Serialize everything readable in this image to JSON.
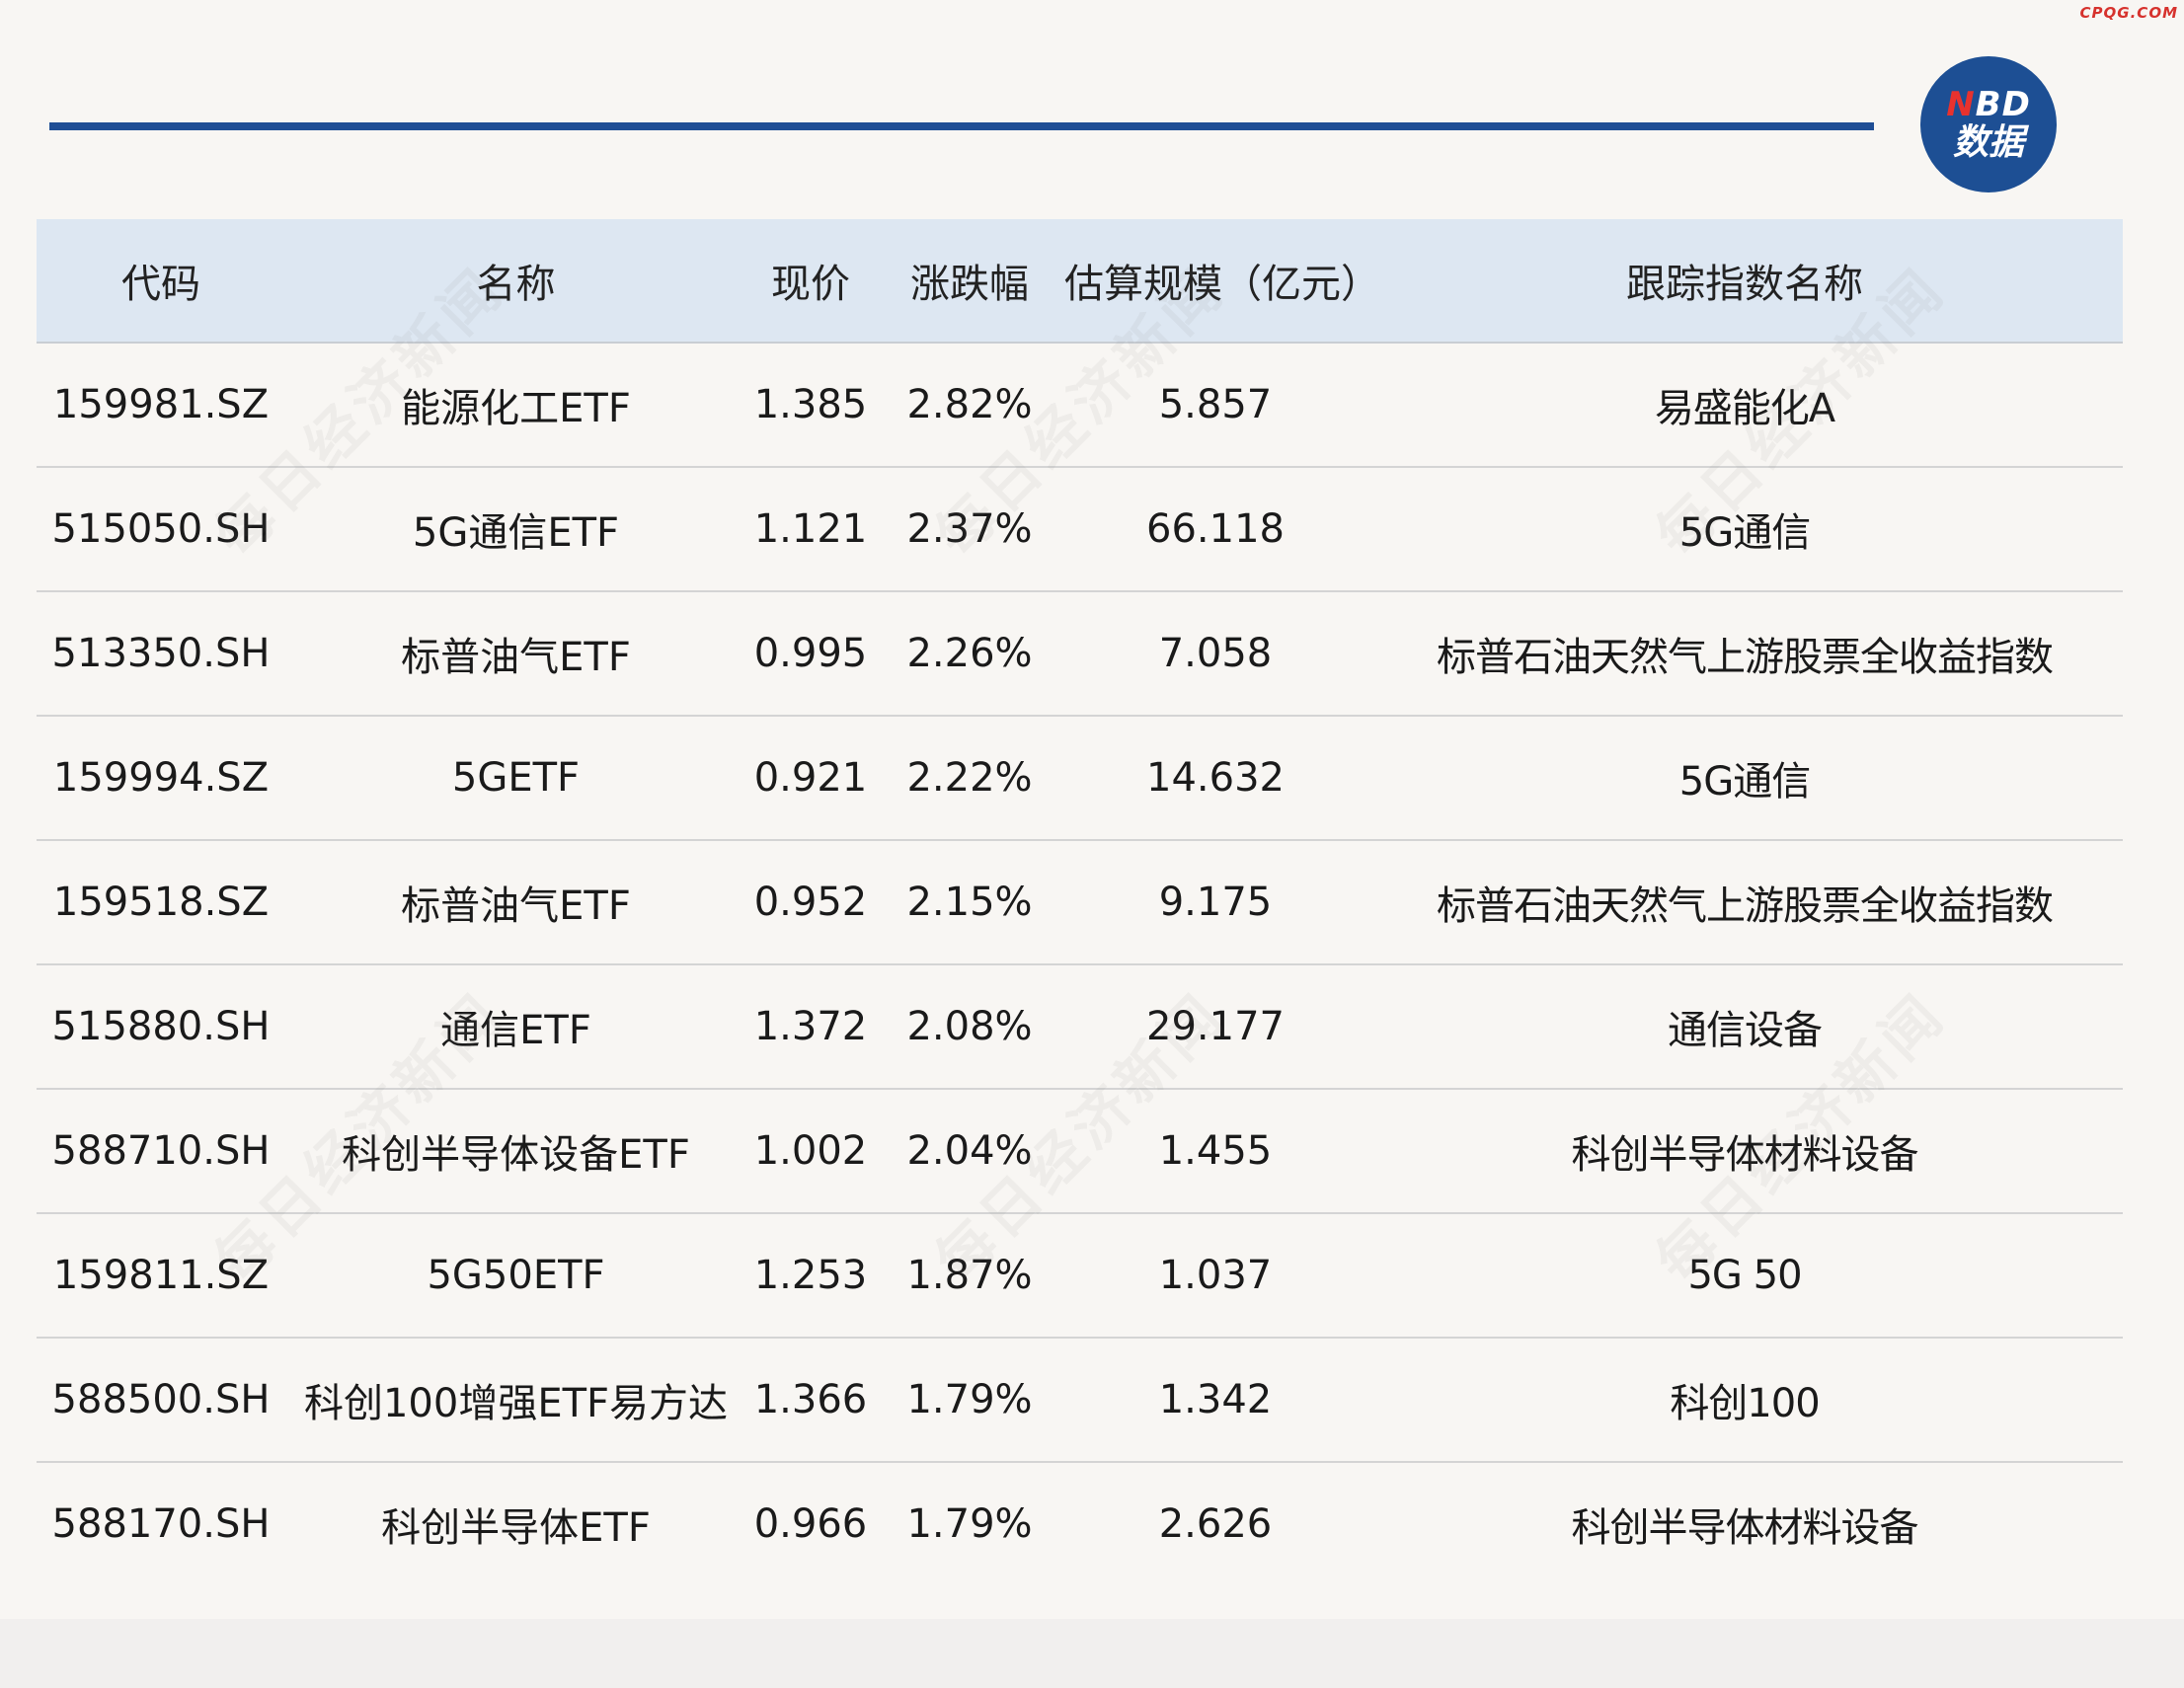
{
  "logo": {
    "brand_n": "N",
    "brand_rest": "BD",
    "sub": "数据"
  },
  "site_mark": "CPQG.COM",
  "watermark_text": "每日经济新闻",
  "colors": {
    "accent_blue": "#1f4e95",
    "header_bg": "#dde7f2",
    "logo_red": "#e8322e"
  },
  "table": {
    "headers": [
      "代码",
      "名称",
      "现价",
      "涨跌幅",
      "估算规模（亿元）",
      "跟踪指数名称"
    ],
    "rows": [
      [
        "159981.SZ",
        "能源化工ETF",
        "1.385",
        "2.82%",
        "5.857",
        "易盛能化A"
      ],
      [
        "515050.SH",
        "5G通信ETF",
        "1.121",
        "2.37%",
        "66.118",
        "5G通信"
      ],
      [
        "513350.SH",
        "标普油气ETF",
        "0.995",
        "2.26%",
        "7.058",
        "标普石油天然气上游股票全收益指数"
      ],
      [
        "159994.SZ",
        "5GETF",
        "0.921",
        "2.22%",
        "14.632",
        "5G通信"
      ],
      [
        "159518.SZ",
        "标普油气ETF",
        "0.952",
        "2.15%",
        "9.175",
        "标普石油天然气上游股票全收益指数"
      ],
      [
        "515880.SH",
        "通信ETF",
        "1.372",
        "2.08%",
        "29.177",
        "通信设备"
      ],
      [
        "588710.SH",
        "科创半导体设备ETF",
        "1.002",
        "2.04%",
        "1.455",
        "科创半导体材料设备"
      ],
      [
        "159811.SZ",
        "5G50ETF",
        "1.253",
        "1.87%",
        "1.037",
        "5G 50"
      ],
      [
        "588500.SH",
        "科创100增强ETF易方达",
        "1.366",
        "1.79%",
        "1.342",
        "科创100"
      ],
      [
        "588170.SH",
        "科创半导体ETF",
        "0.966",
        "1.79%",
        "2.626",
        "科创半导体材料设备"
      ]
    ]
  }
}
